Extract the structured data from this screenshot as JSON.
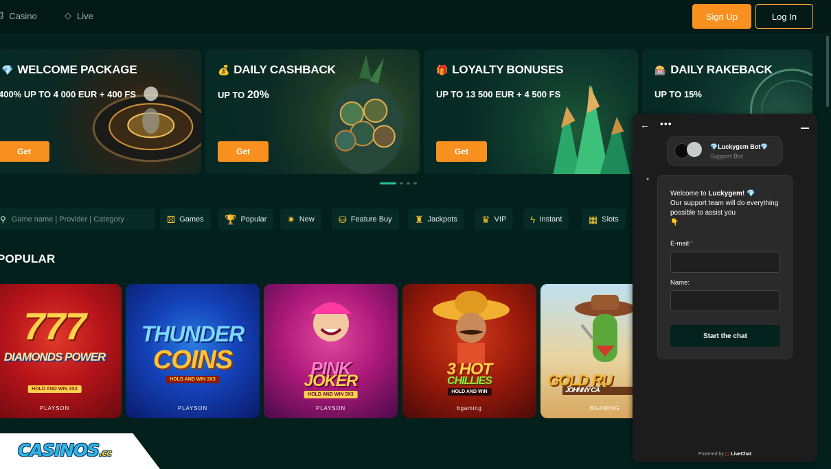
{
  "nav": {
    "casino_label": "Casino",
    "live_label": "Live",
    "signup_label": "Sign Up",
    "login_label": "Log In"
  },
  "promos": [
    {
      "title": "WELCOME PACKAGE",
      "icon": "diamond-icon",
      "emoji": "💎",
      "sub": "400% UP TO 4 000 EUR + 400 FS",
      "button": "Get"
    },
    {
      "title": "DAILY CASHBACK",
      "icon": "money-bag-icon",
      "emoji": "💰",
      "sub_prefix": "UP TO ",
      "sub_value": "20%",
      "button": "Get"
    },
    {
      "title": "LOYALTY BONUSES",
      "icon": "gift-icon",
      "emoji": "🎁",
      "sub": "UP TO 13 500 EUR + 4 500 FS",
      "button": "Get"
    },
    {
      "title": "DAILY RAKEBACK",
      "icon": "slot-machine-icon",
      "emoji": "🎰",
      "sub": "UP TO 15%"
    }
  ],
  "search": {
    "placeholder": "Game name | Provider | Category"
  },
  "categories": [
    {
      "label": "Games",
      "icon": "dice-icon"
    },
    {
      "label": "Popular",
      "icon": "trophy-icon"
    },
    {
      "label": "New",
      "icon": "sparkle-icon"
    },
    {
      "label": "Feature Buy",
      "icon": "coins-icon"
    },
    {
      "label": "Jackpots",
      "icon": "money-bag-icon"
    },
    {
      "label": "VIP",
      "icon": "crown-icon"
    },
    {
      "label": "Instant",
      "icon": "lightning-icon"
    },
    {
      "label": "Slots",
      "icon": "slot-machine-icon"
    }
  ],
  "section_title": "POPULAR",
  "games": [
    {
      "line1": "777",
      "line2": "DIAMONDS POWER",
      "tag": "HOLD AND WIN 3X3",
      "provider": "PLAYSON"
    },
    {
      "line1": "THUNDER",
      "line2": "COINS",
      "tag": "HOLD AND WIN 3X3",
      "provider": "PLAYSON"
    },
    {
      "line1": "PINK",
      "line2": "JOKER",
      "tag": "HOLD AND WIN 3X3",
      "provider": "PLAYSON"
    },
    {
      "line1": "3 HOT",
      "line2": "CHILLIES",
      "tag": "HOLD AND WIN",
      "provider": "bgaming"
    },
    {
      "line1": "GOLD RU",
      "line2": "JOHNNY CA",
      "tag": "",
      "provider": "BGAMING"
    }
  ],
  "logo": {
    "text": "CASINOS",
    "suffix": ".cc"
  },
  "chat": {
    "agent_name": "Luckygem Bot",
    "agent_role": "Support Bot",
    "welcome_prefix": "Welcome to ",
    "welcome_brand": "Luckygem!",
    "welcome_body": "Our support team will do everything possible to assist you",
    "email_label": "E-mail:",
    "required_mark": "*",
    "name_label": "Name:",
    "start_button": "Start the chat",
    "powered_prefix": "Powered by",
    "powered_brand": "LiveChat"
  },
  "colors": {
    "accent": "#f7901e",
    "background": "#03201c",
    "progress": "#22c39a"
  }
}
